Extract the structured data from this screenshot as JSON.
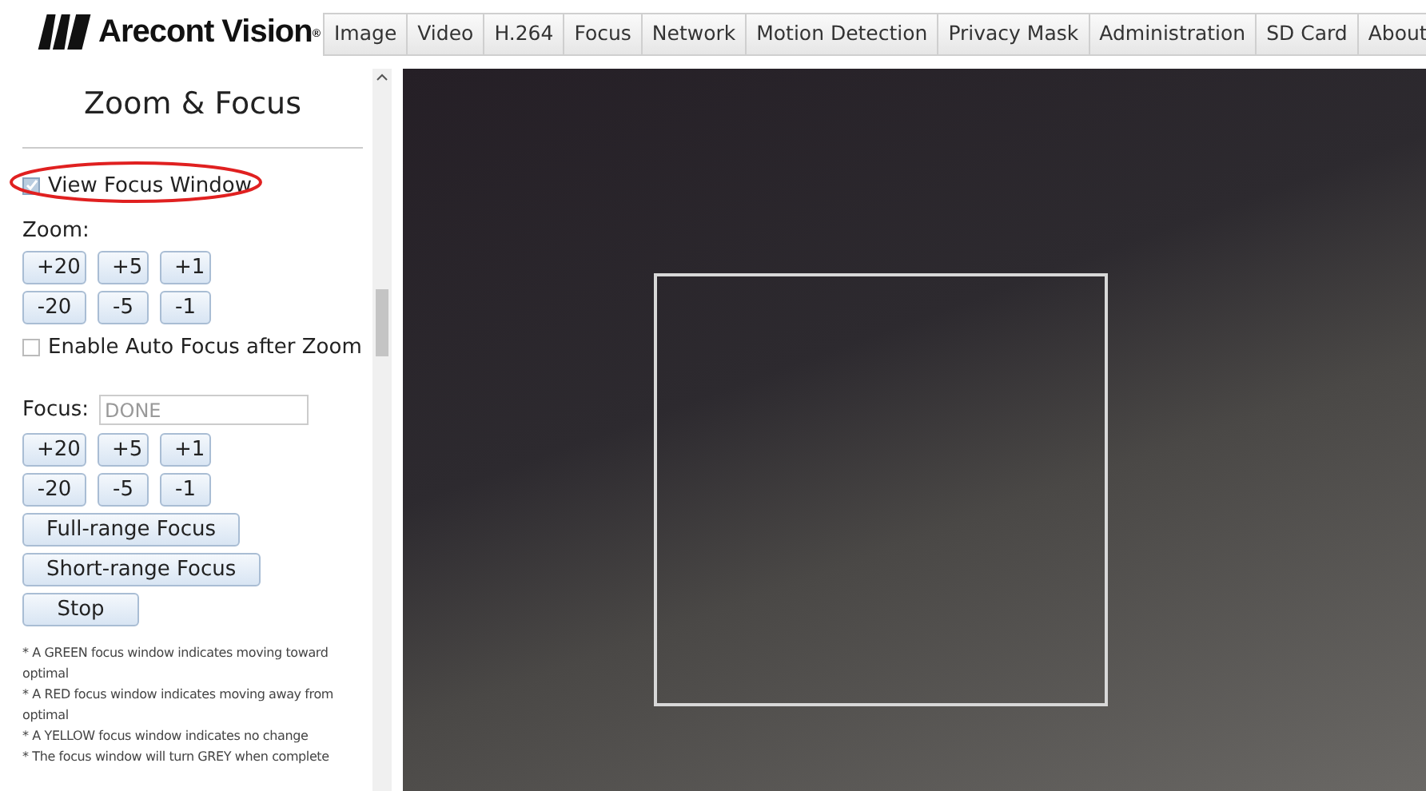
{
  "logo": {
    "text": "Arecont Vision",
    "mark": "®"
  },
  "tabs": [
    {
      "label": "Image",
      "selected": false
    },
    {
      "label": "Video",
      "selected": false
    },
    {
      "label": "H.264",
      "selected": false
    },
    {
      "label": "Focus",
      "selected": false
    },
    {
      "label": "Network",
      "selected": false
    },
    {
      "label": "Motion Detection",
      "selected": false
    },
    {
      "label": "Privacy Mask",
      "selected": false
    },
    {
      "label": "Administration",
      "selected": false
    },
    {
      "label": "SD Card",
      "selected": false
    },
    {
      "label": "About",
      "selected": false
    }
  ],
  "panel": {
    "title": "Zoom & Focus",
    "view_focus_window": {
      "label": "View Focus Window",
      "checked": true,
      "highlighted": true
    },
    "zoom": {
      "label": "Zoom:",
      "buttons": [
        "+20",
        "+5",
        "+1",
        "-20",
        "-5",
        "-1"
      ]
    },
    "auto_focus": {
      "label": "Enable Auto Focus after Zoom",
      "checked": false
    },
    "focus": {
      "label": "Focus:",
      "value": "DONE",
      "buttons": [
        "+20",
        "+5",
        "+1",
        "-20",
        "-5",
        "-1"
      ]
    },
    "actions": [
      "Full-range Focus",
      "Short-range Focus",
      "Stop"
    ],
    "notes": [
      "* A GREEN focus window indicates moving toward optimal",
      "* A RED focus window indicates moving away from optimal",
      "* A YELLOW focus window indicates no change",
      "* The focus window will turn GREY when complete"
    ]
  },
  "camera_view": {
    "focus_window": true
  }
}
